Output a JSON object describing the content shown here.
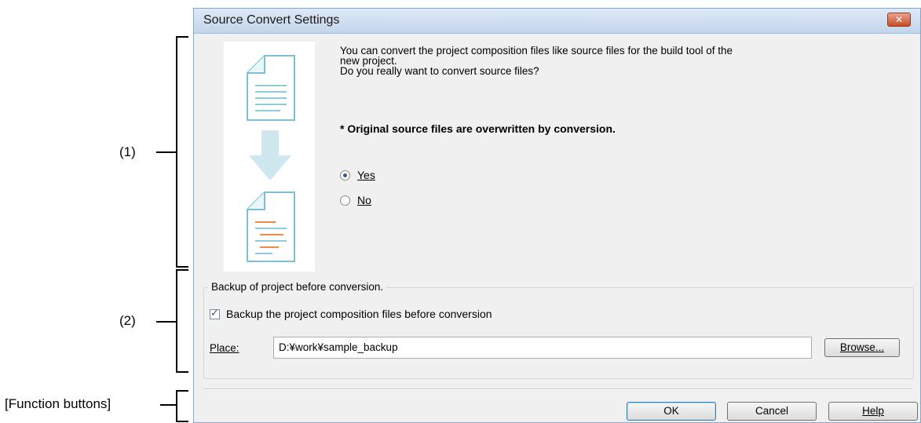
{
  "annotations": {
    "section1": "(1)",
    "section2": "(2)",
    "function_buttons": "[Function buttons]"
  },
  "dialog": {
    "title": "Source Convert Settings",
    "close_glyph": "✕",
    "message_line1": "You can convert the project composition files like source files for the build tool of the",
    "message_line2": "new project.",
    "message_line3": "Do you really want to convert source files?",
    "warning": "* Original source files are overwritten by conversion.",
    "radio_yes_label": "Yes",
    "radio_no_label": "No",
    "radio_selected": "Yes"
  },
  "backup": {
    "group_label": "Backup of project before conversion.",
    "checkbox_label": "Backup the project composition files before conversion",
    "checkbox_checked": true,
    "place_label": "Place:",
    "place_value": "D:¥work¥sample_backup",
    "browse_label": "Browse..."
  },
  "buttons": {
    "ok": "OK",
    "cancel": "Cancel",
    "help": "Help"
  },
  "colors": {
    "doc_outline": "#7dc0d3",
    "doc_lines": "#8fcadb",
    "doc_accent": "#f08a4b",
    "arrow": "#cfe7ee"
  },
  "icons": {
    "source_doc": "document-icon",
    "arrow": "arrow-down-icon",
    "converted_doc": "converted-document-icon"
  }
}
